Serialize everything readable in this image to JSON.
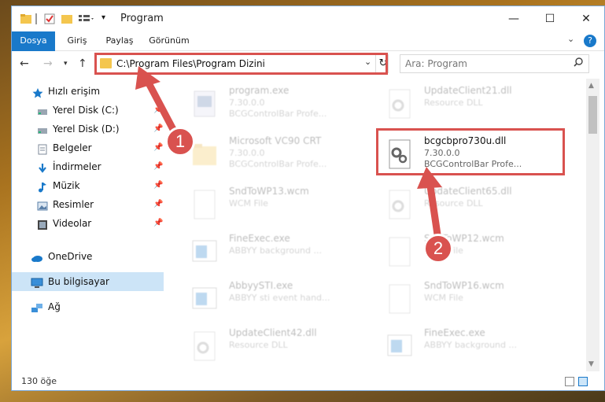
{
  "window": {
    "title": "Program"
  },
  "ribbon": {
    "tabs": [
      {
        "label": "Dosya"
      },
      {
        "label": "Giriş"
      },
      {
        "label": "Paylaş"
      },
      {
        "label": "Görünüm"
      }
    ]
  },
  "address": {
    "path": "C:\\Program Files\\Program Dizini"
  },
  "search": {
    "placeholder": "Ara: Program"
  },
  "sidebar": {
    "items": [
      {
        "label": "Hızlı erişim",
        "icon": "star-icon",
        "color": "#1979ca"
      },
      {
        "label": "Yerel Disk (C:)",
        "icon": "drive-icon",
        "color": "#6c7b8a",
        "pinned": true
      },
      {
        "label": "Yerel Disk (D:)",
        "icon": "drive-icon",
        "color": "#6c7b8a",
        "pinned": true
      },
      {
        "label": "Belgeler",
        "icon": "documents-icon",
        "color": "#7e8a99",
        "pinned": true
      },
      {
        "label": "İndirmeler",
        "icon": "download-icon",
        "color": "#1979ca",
        "pinned": true
      },
      {
        "label": "Müzik",
        "icon": "music-icon",
        "color": "#1979ca",
        "pinned": true
      },
      {
        "label": "Resimler",
        "icon": "pictures-icon",
        "color": "#5a7fa8",
        "pinned": true
      },
      {
        "label": "Videolar",
        "icon": "videos-icon",
        "color": "#444444",
        "pinned": true
      },
      {
        "label": "OneDrive",
        "icon": "cloud-icon",
        "color": "#1979ca"
      },
      {
        "label": "Bu bilgisayar",
        "icon": "computer-icon",
        "color": "#1979ca",
        "selected": true
      },
      {
        "label": "Ağ",
        "icon": "network-icon",
        "color": "#1979ca"
      }
    ]
  },
  "files": [
    {
      "name": "program.exe",
      "line1": "7.30.0.0",
      "line2": "BCGControlBar Profe...",
      "icon": "app-icon",
      "faded": true
    },
    {
      "name": "UpdateClient21.dll",
      "line1": "Resource DLL",
      "line2": "",
      "icon": "dll-gear-icon",
      "faded": true
    },
    {
      "name": "Microsoft VC90 CRT",
      "line1": "7.30.0.0",
      "line2": "BCGControlBar Profe...",
      "icon": "folder-icon",
      "faded": true
    },
    {
      "name": "bcgcbpro730u.dll",
      "line1": "7.30.0.0",
      "line2": "BCGControlBar Profe...",
      "icon": "dll-gear-icon",
      "faded": false,
      "highlighted": true
    },
    {
      "name": "SndToWP13.wcm",
      "line1": "WCM File",
      "line2": "",
      "icon": "blank-file-icon",
      "faded": true
    },
    {
      "name": "UpdateClient65.dll",
      "line1": "Resource DLL",
      "line2": "",
      "icon": "dll-gear-icon",
      "faded": true
    },
    {
      "name": "FineExec.exe",
      "line1": "ABBYY background ...",
      "line2": "",
      "icon": "window-app-icon",
      "faded": true
    },
    {
      "name": "SndToWP12.wcm",
      "line1": "WCM File",
      "line2": "",
      "icon": "blank-file-icon",
      "faded": true
    },
    {
      "name": "AbbyySTI.exe",
      "line1": "ABBYY sti event hand...",
      "line2": "",
      "icon": "window-app-icon",
      "faded": true
    },
    {
      "name": "SndToWP16.wcm",
      "line1": "WCM File",
      "line2": "",
      "icon": "blank-file-icon",
      "faded": true
    },
    {
      "name": "UpdateClient42.dll",
      "line1": "Resource DLL",
      "line2": "",
      "icon": "dll-gear-icon",
      "faded": true
    },
    {
      "name": "FineExec.exe",
      "line1": "ABBYY background ...",
      "line2": "",
      "icon": "window-app-icon",
      "faded": true
    }
  ],
  "status": {
    "count": "130 öğe"
  },
  "annotations": [
    {
      "label": "1",
      "color": "#d9524f"
    },
    {
      "label": "2",
      "color": "#d9524f"
    }
  ]
}
